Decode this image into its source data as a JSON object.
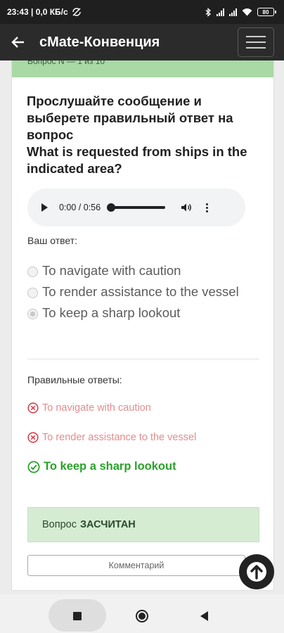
{
  "status_bar": {
    "time_speed": "23:43 | 0,0 КБ/с",
    "battery": "80"
  },
  "app_bar": {
    "title": "cMate-Конвенция"
  },
  "card": {
    "banner_text": "Вопрос N — 1 из 10",
    "question_ru": "Прослушайте сообщение и выберете правильный ответ на вопрос",
    "question_en": "What is requested from ships in the indicated area?",
    "audio": {
      "time": "0:00 / 0:56",
      "progress": 0
    },
    "answer_label": "Ваш ответ:",
    "options": [
      {
        "label": "To navigate with caution",
        "checked": false
      },
      {
        "label": "To render assistance to the vessel",
        "checked": false
      },
      {
        "label": "To keep a sharp lookout",
        "checked": true
      }
    ],
    "correct_label": "Правильные ответы:",
    "results": [
      {
        "label": "To navigate with caution",
        "status": "wrong"
      },
      {
        "label": "To render assistance to the vessel",
        "status": "wrong"
      },
      {
        "label": "To keep a sharp lookout",
        "status": "correct"
      }
    ],
    "status_prefix": "Вопрос",
    "status_value": "ЗАСЧИТАН",
    "comment_button": "Комментарий"
  },
  "colors": {
    "banner": "#a9d9a5",
    "correct": "#2aa22a",
    "wrong": "#e38c8c",
    "status_box": "#d5ecd3"
  }
}
